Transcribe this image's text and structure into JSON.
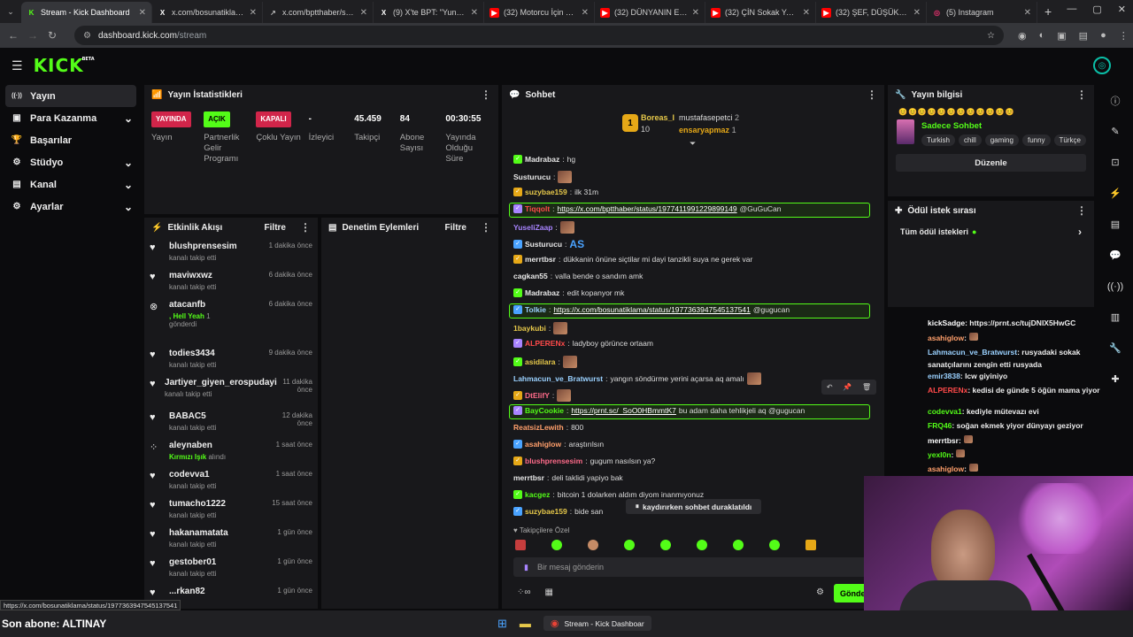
{
  "browser": {
    "tabs": [
      {
        "title": "Stream - Kick Dashboard",
        "icon": "kick-icon",
        "color": "#53fc18",
        "active": true
      },
      {
        "title": "x.com/bosunatiklama/st",
        "icon": "x-icon",
        "color": "#ffffff"
      },
      {
        "title": "x.com/bptthaber/status",
        "icon": "link-icon",
        "color": "#bbbbbb"
      },
      {
        "title": "(9) X'te BPT: \"Yunan dır",
        "icon": "x-icon",
        "color": "#ffffff"
      },
      {
        "title": "(32) Motorcu İçin KÖTÜ",
        "icon": "youtube-icon",
        "color": "#ff0000"
      },
      {
        "title": "(32) DÜNYANIN EN ŞEY",
        "icon": "youtube-icon",
        "color": "#ff0000"
      },
      {
        "title": "(32) ÇİN Sokak Yemekle",
        "icon": "youtube-icon",
        "color": "#ff0000"
      },
      {
        "title": "(32) ŞEF, DÜŞÜK PUANI",
        "icon": "youtube-icon",
        "color": "#ff0000"
      },
      {
        "title": "(5) Instagram",
        "icon": "instagram-icon",
        "color": "#e1306c"
      }
    ],
    "url_host": "dashboard.kick.com",
    "url_path": "/stream"
  },
  "sidebar": {
    "items": [
      {
        "label": "Yayın",
        "icon": "broadcast-icon"
      },
      {
        "label": "Para Kazanma",
        "icon": "money-icon"
      },
      {
        "label": "Başarılar",
        "icon": "trophy-icon"
      },
      {
        "label": "Stüdyo",
        "icon": "studio-icon"
      },
      {
        "label": "Kanal",
        "icon": "channel-icon"
      },
      {
        "label": "Ayarlar",
        "icon": "settings-icon"
      }
    ]
  },
  "stats_panel": {
    "title": "Yayın İstatistikleri",
    "items": [
      {
        "value": "YAYINDA",
        "label": "Yayın",
        "kind": "badge-red"
      },
      {
        "value": "AÇIK",
        "label": "Partnerlik Gelir Programı",
        "kind": "badge-green"
      },
      {
        "value": "KAPALI",
        "label": "Çoklu Yayın",
        "kind": "badge-red"
      },
      {
        "value": "-",
        "label": "İzleyici",
        "kind": "text"
      },
      {
        "value": "45.459",
        "label": "Takipçi",
        "kind": "text"
      },
      {
        "value": "84",
        "label": "Abone Sayısı",
        "kind": "text"
      },
      {
        "value": "00:30:55",
        "label": "Yayında Olduğu Süre",
        "kind": "text"
      }
    ]
  },
  "activity": {
    "title": "Etkinlik Akışı",
    "filter": "Filtre",
    "events": [
      {
        "name": "blushprensesim",
        "sub": "kanalı takip etti",
        "time": "1 dakika önce"
      },
      {
        "name": "maviwxwz",
        "sub": "kanalı takip etti",
        "time": "6 dakika önce"
      },
      {
        "name": "atacanfb",
        "sub": ", Hell Yeah",
        "sub2": "1",
        "sub3": "gönderdi",
        "time": "6 dakika önce",
        "kind": "kick"
      },
      {
        "name": "todies3434",
        "sub": "kanalı takip etti",
        "time": "9 dakika önce"
      },
      {
        "name": "Jartiyer_giyen_erospudayi",
        "sub": "kanalı takip etti",
        "time": "11 dakika önce"
      },
      {
        "name": "BABAC5",
        "sub": "kanalı takip etti",
        "time": "12 dakika önce"
      },
      {
        "name": "aleynaben",
        "sub": "Kırmızı Işık",
        "sub2": "alındı",
        "time": "1 saat önce",
        "kind": "reward"
      },
      {
        "name": "codevva1",
        "sub": "kanalı takip etti",
        "time": "1 saat önce"
      },
      {
        "name": "tumacho1222",
        "sub": "kanalı takip etti",
        "time": "15 saat önce"
      },
      {
        "name": "hakanamatata",
        "sub": "kanalı takip etti",
        "time": "1 gün önce"
      },
      {
        "name": "gestober01",
        "sub": "kanalı takip etti",
        "time": "1 gün önce"
      },
      {
        "name": "...rkan82",
        "sub": "",
        "time": "1 gün önce"
      }
    ]
  },
  "moderation": {
    "title": "Denetim Eylemleri",
    "filter": "Filtre"
  },
  "chat": {
    "title": "Sohbet",
    "top": [
      {
        "name": "Boreas_I",
        "value": "10"
      },
      {
        "name": "mustafasepetci",
        "value": "2"
      },
      {
        "name": "ensaryapmaz",
        "value": "1"
      }
    ],
    "messages": [
      {
        "user": "Madrabaz",
        "color": "#e8e8e8",
        "text": "hg"
      },
      {
        "user": "Susturucu",
        "color": "#e8e8e8",
        "text": "",
        "emote": true
      },
      {
        "user": "suzybae159",
        "color": "#e6c84a",
        "text": "ilk 31m"
      },
      {
        "user": "Tiqqolt",
        "color": "#ff4a4a",
        "text": "",
        "link": "https://x.com/bptthaber/status/1977411991229899149",
        "tail": "@GuGuCan",
        "highlight": true
      },
      {
        "user": "YuseliZaap",
        "color": "#a884ff",
        "text": "",
        "emote": true
      },
      {
        "user": "Susturucu",
        "color": "#e8e8e8",
        "text": "",
        "emote2": true
      },
      {
        "user": "merrtbsr",
        "color": "#e8e8e8",
        "text": "dükkanin önüne siçtilar mi dayi tanzikli suya ne gerek var"
      },
      {
        "user": "cagkan55",
        "color": "#e8e8e8",
        "text": "valla bende o sandım amk"
      },
      {
        "user": "Madrabaz",
        "color": "#e8e8e8",
        "text": "edit kopanyor mk"
      },
      {
        "user": "Tolkie",
        "color": "#9ad1ff",
        "text": "",
        "link": "https://x.com/bosunatiklama/status/1977363947545137541",
        "tail": "@gugucan",
        "highlight": true
      },
      {
        "user": "1baykubi",
        "color": "#e6c84a",
        "text": "",
        "emote": true
      },
      {
        "user": "ALPERENx",
        "color": "#ff4a4a",
        "text": "ladyboy görünce ortaam"
      },
      {
        "user": "asidilara",
        "color": "#e6c84a",
        "text": "",
        "emote": true
      },
      {
        "user": "Lahmacun_ve_Bratwurst",
        "color": "#9ad1ff",
        "text": "yangın söndürme yerini açarsa aq amalı",
        "emote": true
      },
      {
        "user": "DtElifY",
        "color": "#ff6b8a",
        "text": "",
        "emote": true
      },
      {
        "user": "BayCookie",
        "color": "#53fc18",
        "text": "",
        "link": "https://prnt.sc/_SoO0HBmmtK7",
        "tail": "bu adam daha tehlikjeli aq @gugucan",
        "highlight": true
      },
      {
        "user": "ReatsizLewith",
        "color": "#ff9f6b",
        "text": "800"
      },
      {
        "user": "asahiglow",
        "color": "#ff9f6b",
        "text": "araştırılsın"
      },
      {
        "user": "blushprensesim",
        "color": "#ff6b8a",
        "text": "gugum nasılsın ya?"
      },
      {
        "user": "merrtbsr",
        "color": "#e8e8e8",
        "text": "deli taklidi yapiyo bak"
      },
      {
        "user": "kacgez",
        "color": "#53fc18",
        "text": "bitcoin 1 dolarken aldım diyom inanmıyonuz"
      },
      {
        "user": "suzybae159",
        "color": "#e6c84a",
        "text": "bide san"
      }
    ],
    "paused": "kaydırırken sohbet duraklatıldı",
    "followers_only": "Takipçilere Özel",
    "input_placeholder": "Bir mesaj gönderin",
    "send": "Gönder"
  },
  "stream_info": {
    "title": "Yayın bilgisi",
    "category": "Sadece Sohbet",
    "tags": [
      "Turkish",
      "chill",
      "gaming",
      "funny",
      "Türkçe"
    ],
    "edit": "Düzenle"
  },
  "rewards": {
    "title": "Ödül istek sırası",
    "all": "Tüm ödül istekleri"
  },
  "overlay_chat": [
    {
      "user": "kickSadge",
      "text": ": https://prnt.sc/tujDNIX5HwGC",
      "color": "#ffffff"
    },
    {
      "user": "asahiglow",
      "text": ":",
      "color": "#ff9f6b",
      "emote": true
    },
    {
      "user": "Lahmacun_ve_Bratwurst",
      "text": ": rusyadaki sokak sanatçılarını zengin etti rusyada",
      "color": "#9ad1ff"
    },
    {
      "user": "emir3838",
      "text": ": lcw giyiniyo",
      "color": "#9ad1ff"
    },
    {
      "user": "ALPERENx",
      "text": ": kedisi de günde 5 öğün mama yiyor",
      "color": "#ff4a4a"
    },
    {
      "user": "codevva1",
      "text": ": kediyle mütevazı evi",
      "color": "#53fc18"
    },
    {
      "user": "FRQ46",
      "text": ": soğan ekmek yiyor dünyayı geziyor",
      "color": "#53fc18"
    },
    {
      "user": "merrtbsr",
      "text": ":",
      "color": "#ffffff",
      "emote": true
    },
    {
      "user": "yexl0n",
      "text": ":",
      "color": "#53fc18",
      "emote": true
    },
    {
      "user": "asahiglow",
      "text": ":",
      "color": "#ff9f6b",
      "emote": true
    }
  ],
  "status_url": "https://x.com/bosunatiklama/status/1977363947545137541",
  "son_abone": "Son abone: ALTINAY",
  "taskbar_app": "Stream - Kick Dashboar"
}
